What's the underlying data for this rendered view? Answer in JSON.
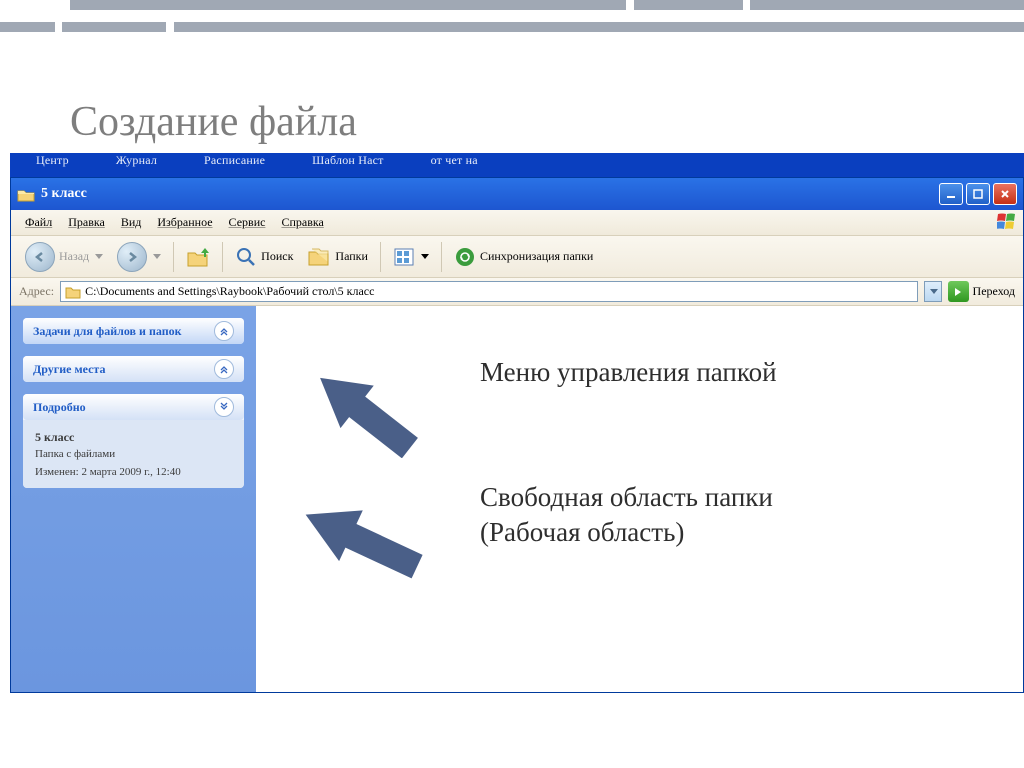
{
  "slide": {
    "title": "Создание файла"
  },
  "blue_strip": {
    "items": [
      "Центр",
      "Журнал",
      "Расписание",
      "Шаблон   Наст",
      "от чет на"
    ]
  },
  "window": {
    "title": "5 класс",
    "menu": {
      "file": "Файл",
      "edit": "Правка",
      "view": "Вид",
      "fav": "Избранное",
      "tools": "Сервис",
      "help": "Справка"
    },
    "toolbar": {
      "back": "Назад",
      "search": "Поиск",
      "folders": "Папки",
      "sync": "Синхронизация папки"
    },
    "address": {
      "label": "Адрес:",
      "path": "C:\\Documents and Settings\\Raybook\\Рабочий стол\\5 класс",
      "go": "Переход"
    },
    "sidebar": {
      "tasks": {
        "title": "Задачи для файлов и папок"
      },
      "places": {
        "title": "Другие места"
      },
      "details": {
        "title": "Подробно",
        "name": "5 класс",
        "type": "Папка с файлами",
        "modified": "Изменен: 2 марта 2009 г., 12:40"
      }
    }
  },
  "annotations": {
    "a1": "Меню управления папкой",
    "a2": "Свободная область папки (Рабочая область)"
  }
}
